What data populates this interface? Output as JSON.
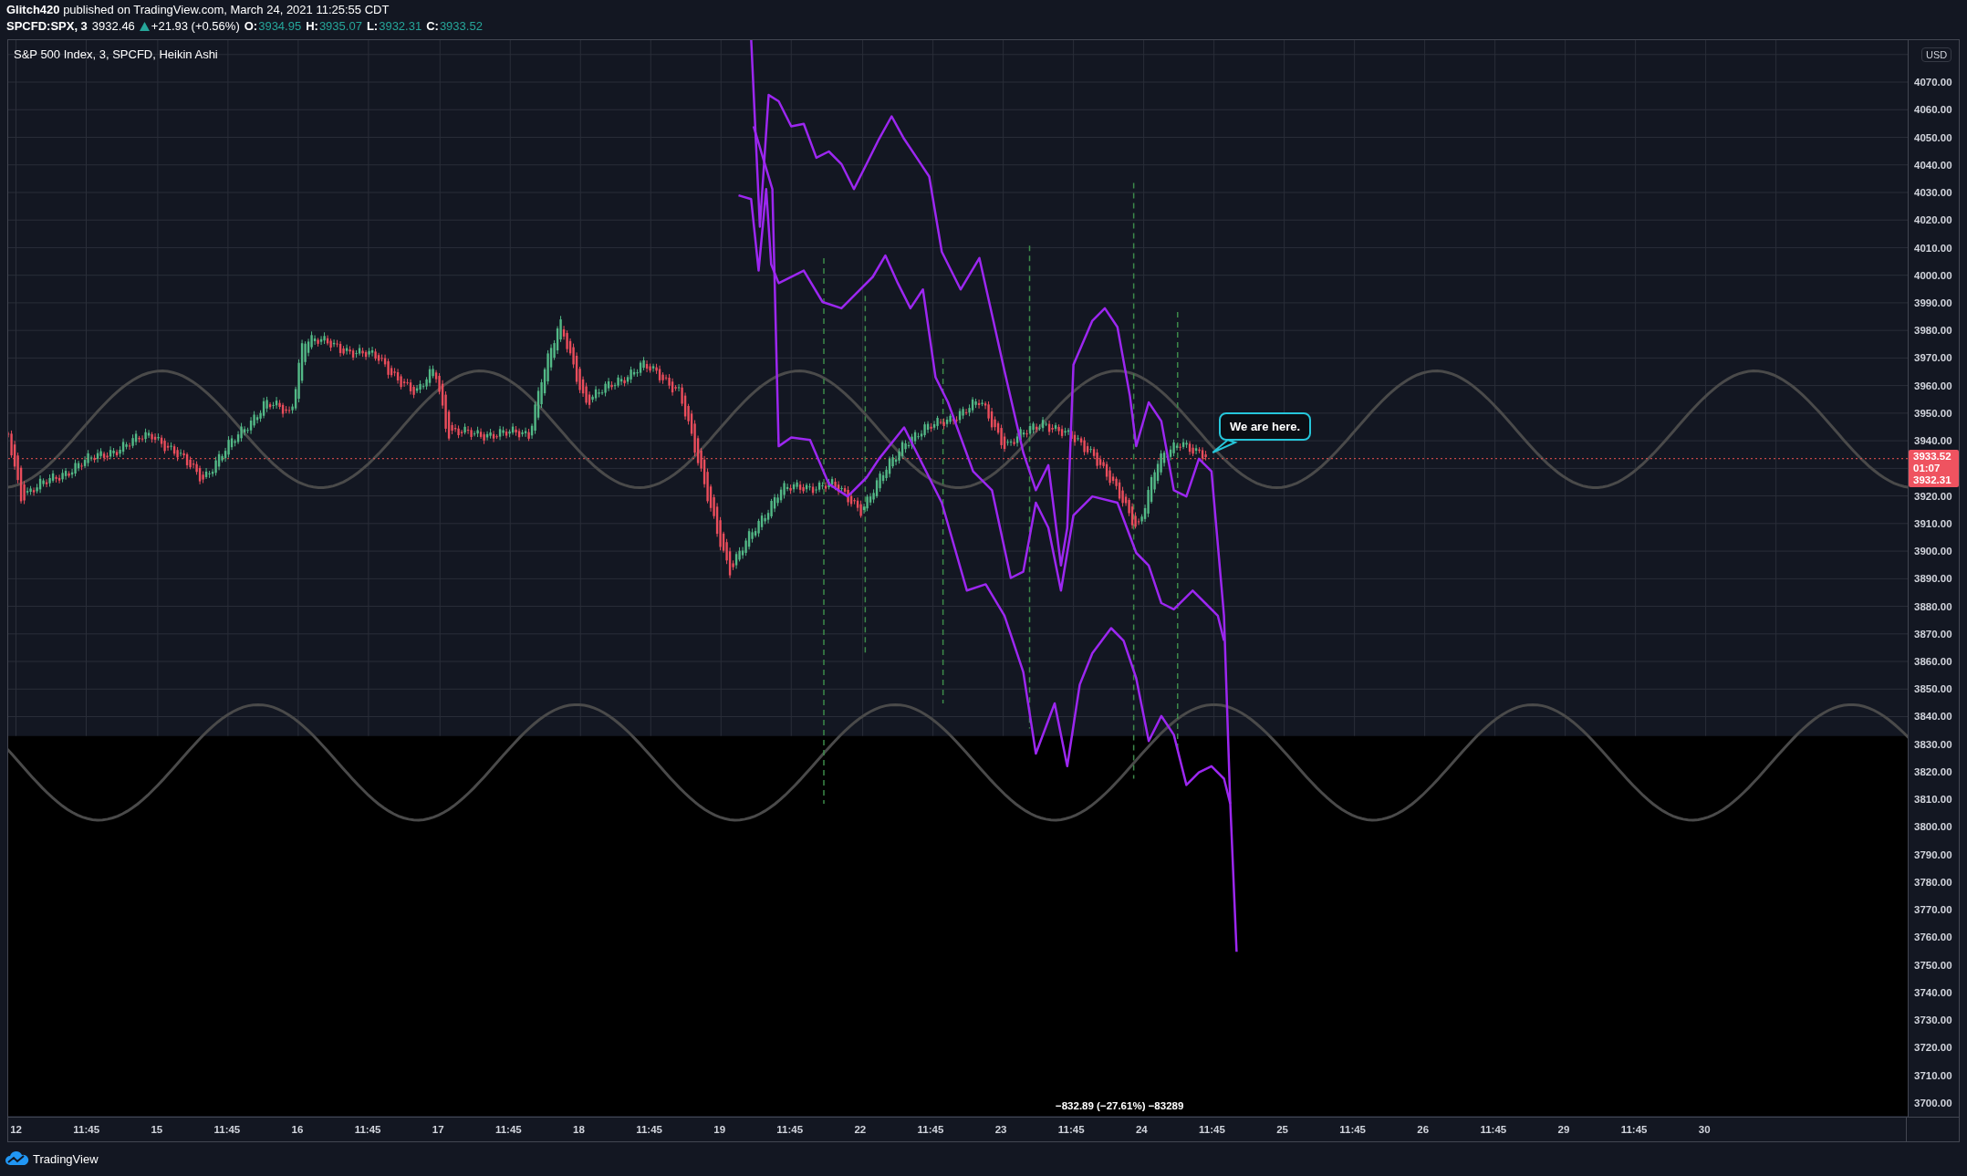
{
  "header": {
    "published": "**Glitch420** published on TradingView.com, March 24, 2021 11:25:55 CDT"
  },
  "quote": {
    "symbol": "SPCFD:SPX, 3",
    "last": "3932.46",
    "rising": true,
    "change": "+21.93 (+0.56%)",
    "ohlc": [
      {
        "label": "O:",
        "value": "3934.95"
      },
      {
        "label": "H:",
        "value": "3935.07"
      },
      {
        "label": "L:",
        "value": "3932.31"
      },
      {
        "label": "C:",
        "value": "3933.52"
      }
    ]
  },
  "chart": {
    "legend": "S&P 500 Index, 3, SPCFD, Heikin Ashi",
    "callout": "We are here.",
    "measure": "−832.89 (−27.61%) −83289",
    "price_scale": {
      "currency": "USD",
      "upper": [
        "4070.00",
        "4060.00",
        "4050.00",
        "4040.00",
        "4030.00",
        "4020.00",
        "4010.00",
        "4000.00",
        "3990.00",
        "3980.00",
        "3970.00",
        "3960.00",
        "3950.00",
        "3940.00"
      ],
      "lower": [
        "3920.00",
        "3910.00",
        "3900.00",
        "3890.00",
        "3880.00",
        "3870.00",
        "3860.00",
        "3850.00",
        "3840.00",
        "3830.00",
        "3820.00",
        "3810.00",
        "3800.00",
        "3790.00",
        "3780.00",
        "3770.00",
        "3760.00",
        "3750.00",
        "3740.00",
        "3730.00",
        "3720.00",
        "3710.00",
        "3700.00"
      ]
    },
    "price_badge": {
      "close": "3933.52",
      "countdown": "01:07",
      "low": "3932.31"
    },
    "time_scale": [
      "12",
      "11:45",
      "15",
      "11:45",
      "16",
      "11:45",
      "17",
      "11:45",
      "18",
      "11:45",
      "19",
      "11:45",
      "22",
      "11:45",
      "23",
      "11:45",
      "24",
      "11:45",
      "25",
      "11:45",
      "26",
      "11:45",
      "29",
      "11:45",
      "30"
    ]
  },
  "footer": {
    "brand": "TradingView"
  }
}
